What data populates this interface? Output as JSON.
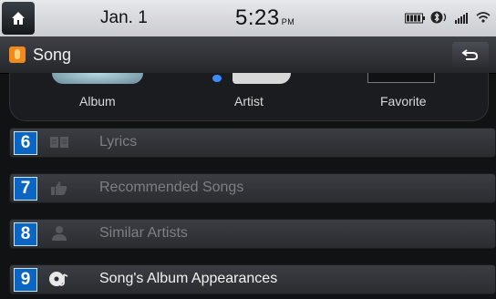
{
  "status": {
    "date": "Jan.  1",
    "time": "5:23",
    "ampm": "PM"
  },
  "title": {
    "text": "Song",
    "app_icon": "music-app-icon",
    "back_icon": "back-arrow-icon"
  },
  "tabs": [
    {
      "label": "Album"
    },
    {
      "label": "Artist"
    },
    {
      "label": "Favorite"
    }
  ],
  "list": [
    {
      "number": "6",
      "label": "Lyrics",
      "icon": "lyrics-book-icon",
      "enabled": false
    },
    {
      "number": "7",
      "label": "Recommended Songs",
      "icon": "thumbs-up-icon",
      "enabled": false
    },
    {
      "number": "8",
      "label": "Similar Artists",
      "icon": "person-icon",
      "enabled": false
    },
    {
      "number": "9",
      "label": "Song's Album Appearances",
      "icon": "album-disc-icon",
      "enabled": true
    }
  ],
  "colors": {
    "accent_badge": "#0a66c2",
    "app_icon": "#f08a1c",
    "disabled_text": "#7d7f83"
  }
}
